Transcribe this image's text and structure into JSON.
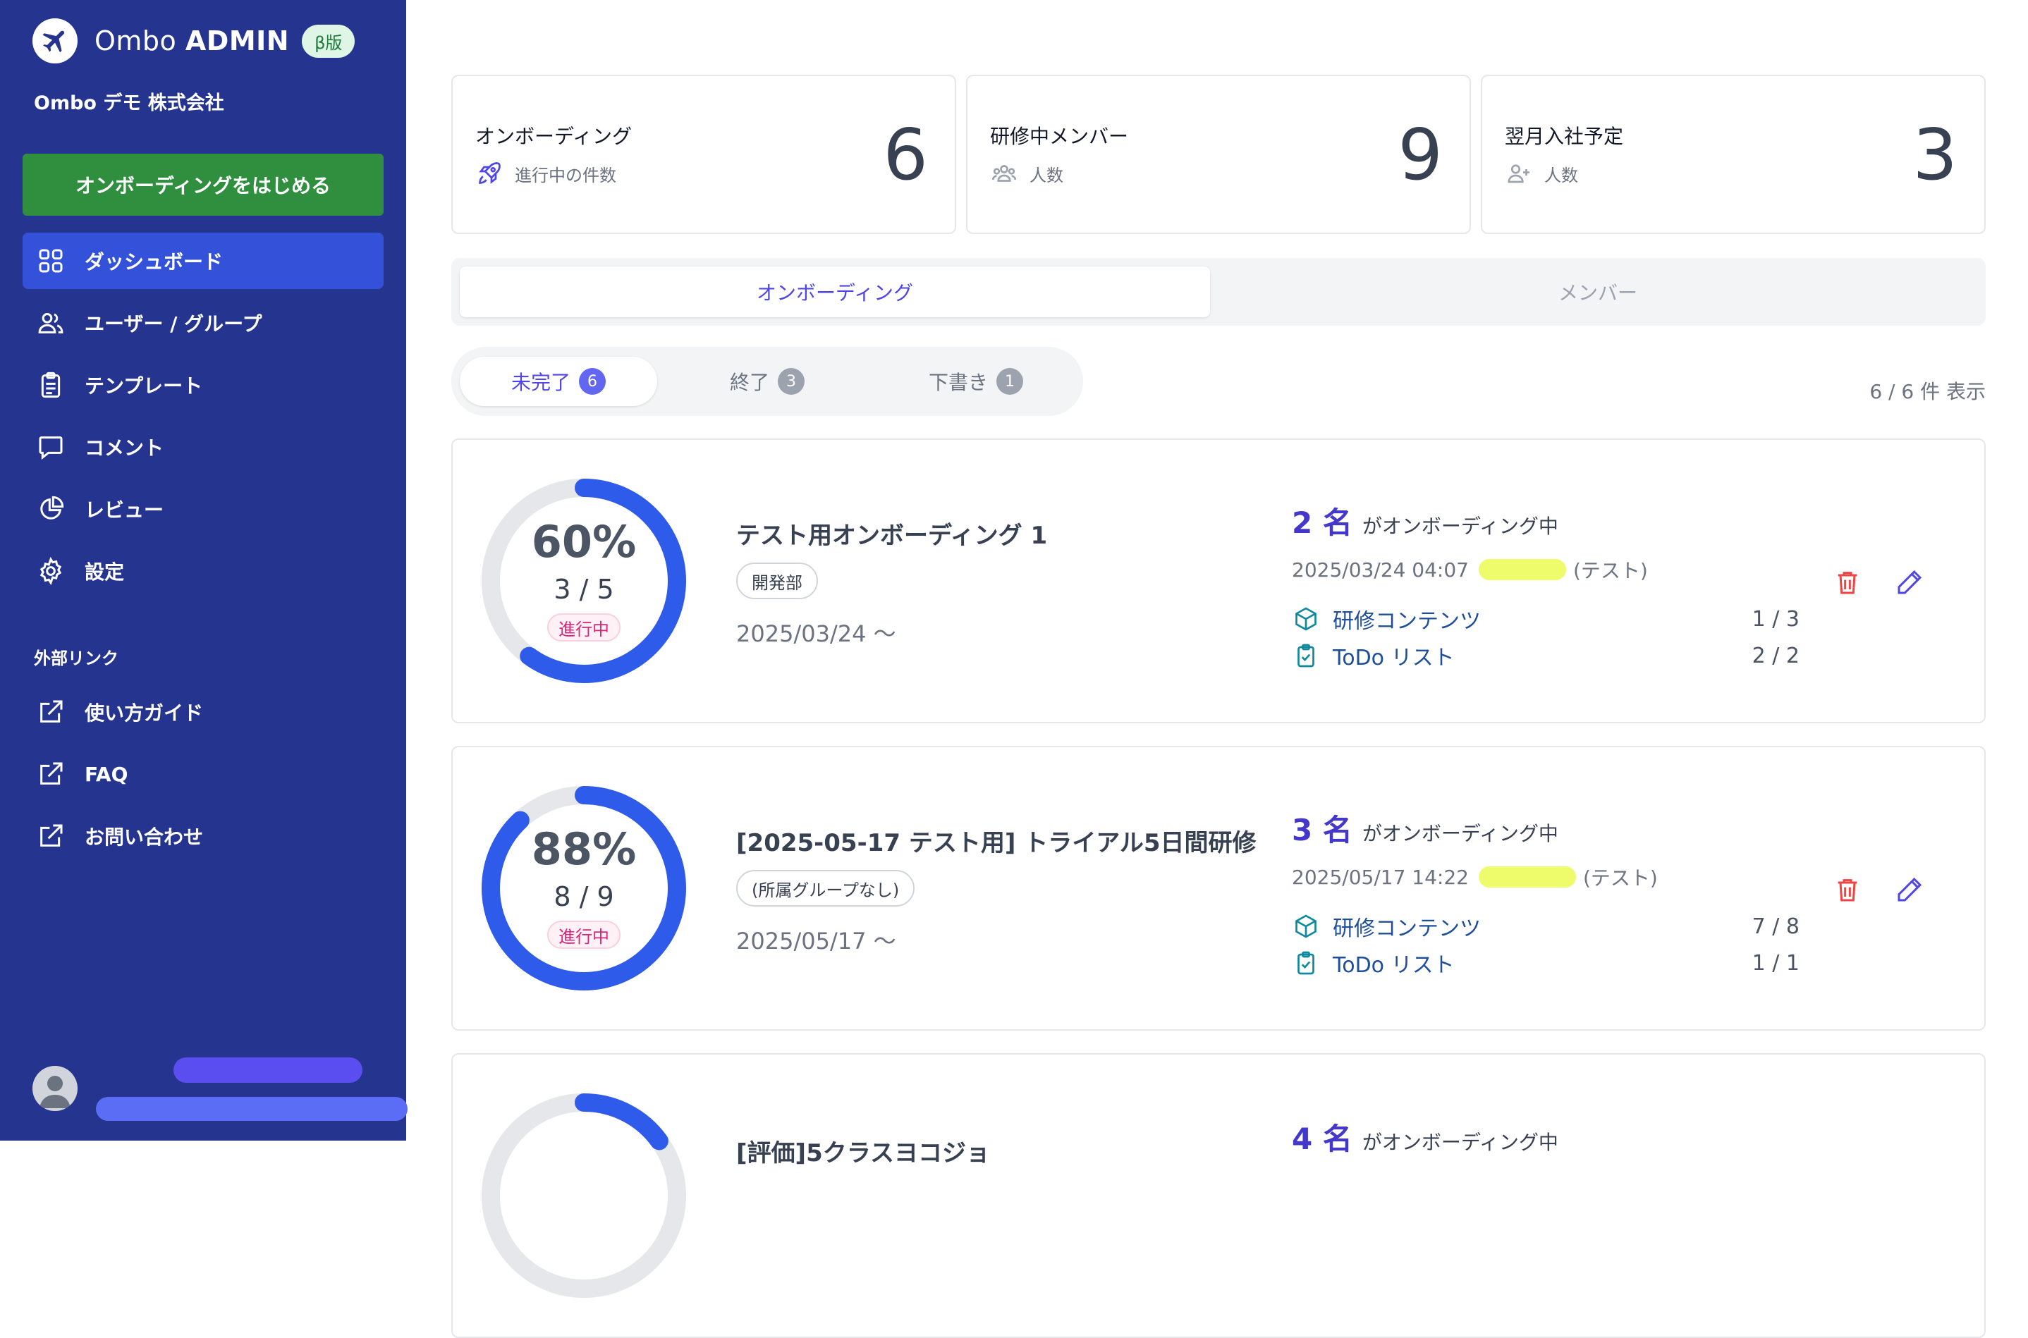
{
  "brand": {
    "name_light": "Ombo",
    "name_bold": "ADMIN",
    "badge": "β版"
  },
  "company": "Ombo デモ 株式会社",
  "start_button": "オンボーディングをはじめる",
  "nav": [
    {
      "label": "ダッシュボード",
      "icon": "dashboard-grid-icon",
      "active": true
    },
    {
      "label": "ユーザー / グループ",
      "icon": "users-icon"
    },
    {
      "label": "テンプレート",
      "icon": "clipboard-icon"
    },
    {
      "label": "コメント",
      "icon": "comment-icon"
    },
    {
      "label": "レビュー",
      "icon": "pie-chart-icon"
    },
    {
      "label": "設定",
      "icon": "gear-icon"
    }
  ],
  "external_section": "外部リンク",
  "external_links": [
    {
      "label": "使い方ガイド",
      "icon": "external-link-icon"
    },
    {
      "label": "FAQ",
      "icon": "external-link-icon"
    },
    {
      "label": "お問い合わせ",
      "icon": "external-link-icon"
    }
  ],
  "stats": [
    {
      "title": "オンボーディング",
      "sub": "進行中の件数",
      "value": "6",
      "icon": "rocket-icon"
    },
    {
      "title": "研修中メンバー",
      "sub": "人数",
      "value": "9",
      "icon": "group-icon"
    },
    {
      "title": "翌月入社予定",
      "sub": "人数",
      "value": "3",
      "icon": "user-plus-icon"
    }
  ],
  "tabs": {
    "active": "オンボーディング",
    "inactive": "メンバー"
  },
  "filters": [
    {
      "label": "未完了",
      "count": "6",
      "active": true
    },
    {
      "label": "終了",
      "count": "3"
    },
    {
      "label": "下書き",
      "count": "1"
    }
  ],
  "display_count": "6 / 6 件 表示",
  "cards": [
    {
      "percent": "60%",
      "percent_value": 60,
      "fraction": "3 / 5",
      "status": "進行中",
      "title": "テスト用オンボーディング 1",
      "tag": "開発部",
      "start": "2025/03/24 〜",
      "members": "2 名",
      "members_suffix": "がオンボーディング中",
      "last_time": "2025/03/24 04:07",
      "last_suffix": "(テスト)",
      "content_label": "研修コンテンツ",
      "content_value": "1 / 3",
      "todo_label": "ToDo リスト",
      "todo_value": "2 / 2"
    },
    {
      "percent": "88%",
      "percent_value": 88,
      "fraction": "8 / 9",
      "status": "進行中",
      "title": "[2025-05-17 テスト用] トライアル5日間研修",
      "tag": "(所属グループなし)",
      "start": "2025/05/17 〜",
      "members": "3 名",
      "members_suffix": "がオンボーディング中",
      "last_time": "2025/05/17 14:22",
      "last_suffix": "(テスト)",
      "content_label": "研修コンテンツ",
      "content_value": "7 / 8",
      "todo_label": "ToDo リスト",
      "todo_value": "1 / 1"
    },
    {
      "percent_value": 15,
      "title": "[評価]5クラスヨコジョ",
      "members": "4 名",
      "members_suffix": "がオンボーディング中"
    }
  ],
  "colors": {
    "sidebar": "#25358f",
    "accent": "#2f5bea",
    "primary_green": "#2f8f3f",
    "delete": "#ef4444",
    "edit": "#4f46e5"
  }
}
